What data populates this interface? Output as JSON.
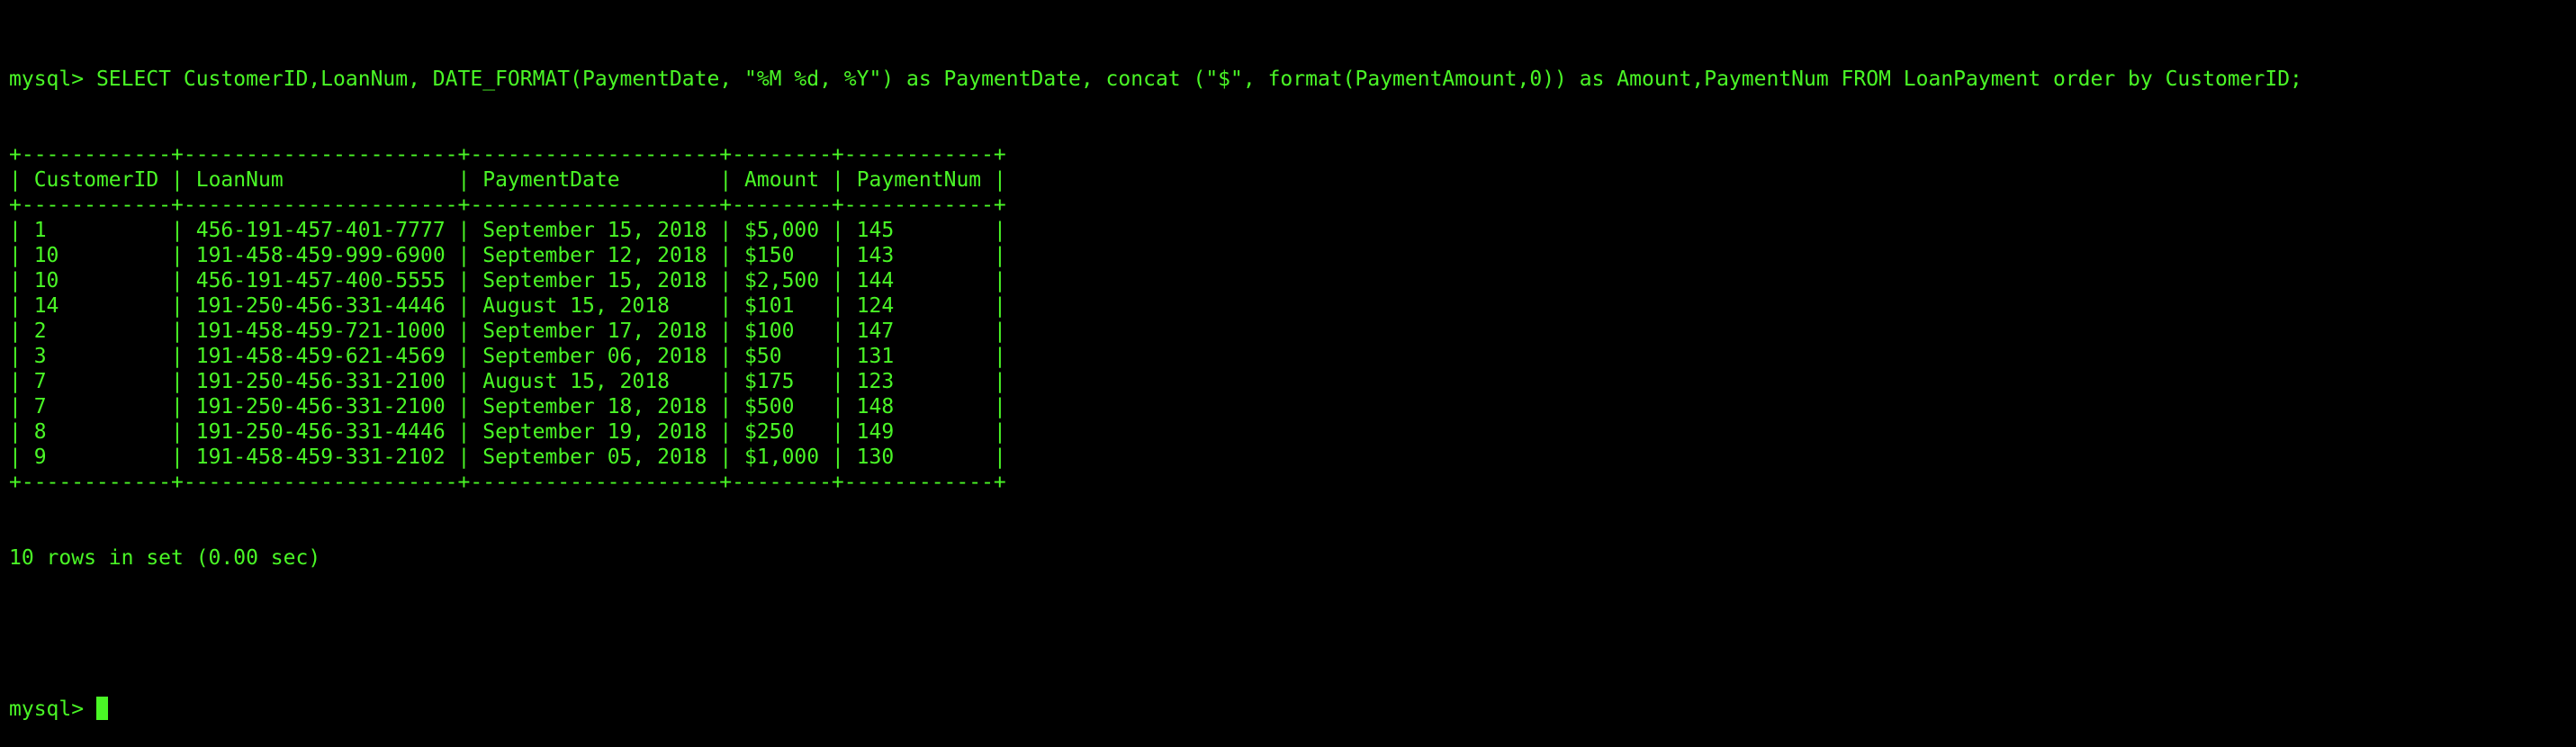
{
  "terminal": {
    "prompt": "mysql> ",
    "command": "SELECT CustomerID,LoanNum, DATE_FORMAT(PaymentDate, \"%M %d, %Y\") as PaymentDate, concat (\"$\", format(PaymentAmount,0)) as Amount,PaymentNum FROM LoanPayment order by CustomerID;",
    "table": {
      "columns": [
        "CustomerID",
        "LoanNum",
        "PaymentDate",
        "Amount",
        "PaymentNum"
      ],
      "rows": [
        [
          "1",
          "456-191-457-401-7777",
          "September 15, 2018",
          "$5,000",
          "145"
        ],
        [
          "10",
          "191-458-459-999-6900",
          "September 12, 2018",
          "$150",
          "143"
        ],
        [
          "10",
          "456-191-457-400-5555",
          "September 15, 2018",
          "$2,500",
          "144"
        ],
        [
          "14",
          "191-250-456-331-4446",
          "August 15, 2018",
          "$101",
          "124"
        ],
        [
          "2",
          "191-458-459-721-1000",
          "September 17, 2018",
          "$100",
          "147"
        ],
        [
          "3",
          "191-458-459-621-4569",
          "September 06, 2018",
          "$50",
          "131"
        ],
        [
          "7",
          "191-250-456-331-2100",
          "August 15, 2018",
          "$175",
          "123"
        ],
        [
          "7",
          "191-250-456-331-2100",
          "September 18, 2018",
          "$500",
          "148"
        ],
        [
          "8",
          "191-250-456-331-4446",
          "September 19, 2018",
          "$250",
          "149"
        ],
        [
          "9",
          "191-458-459-331-2102",
          "September 05, 2018",
          "$1,000",
          "130"
        ]
      ]
    },
    "status": "10 rows in set (0.00 sec)",
    "final_prompt": "mysql> ",
    "colors": {
      "foreground": "#4af626",
      "background": "#000000"
    }
  }
}
